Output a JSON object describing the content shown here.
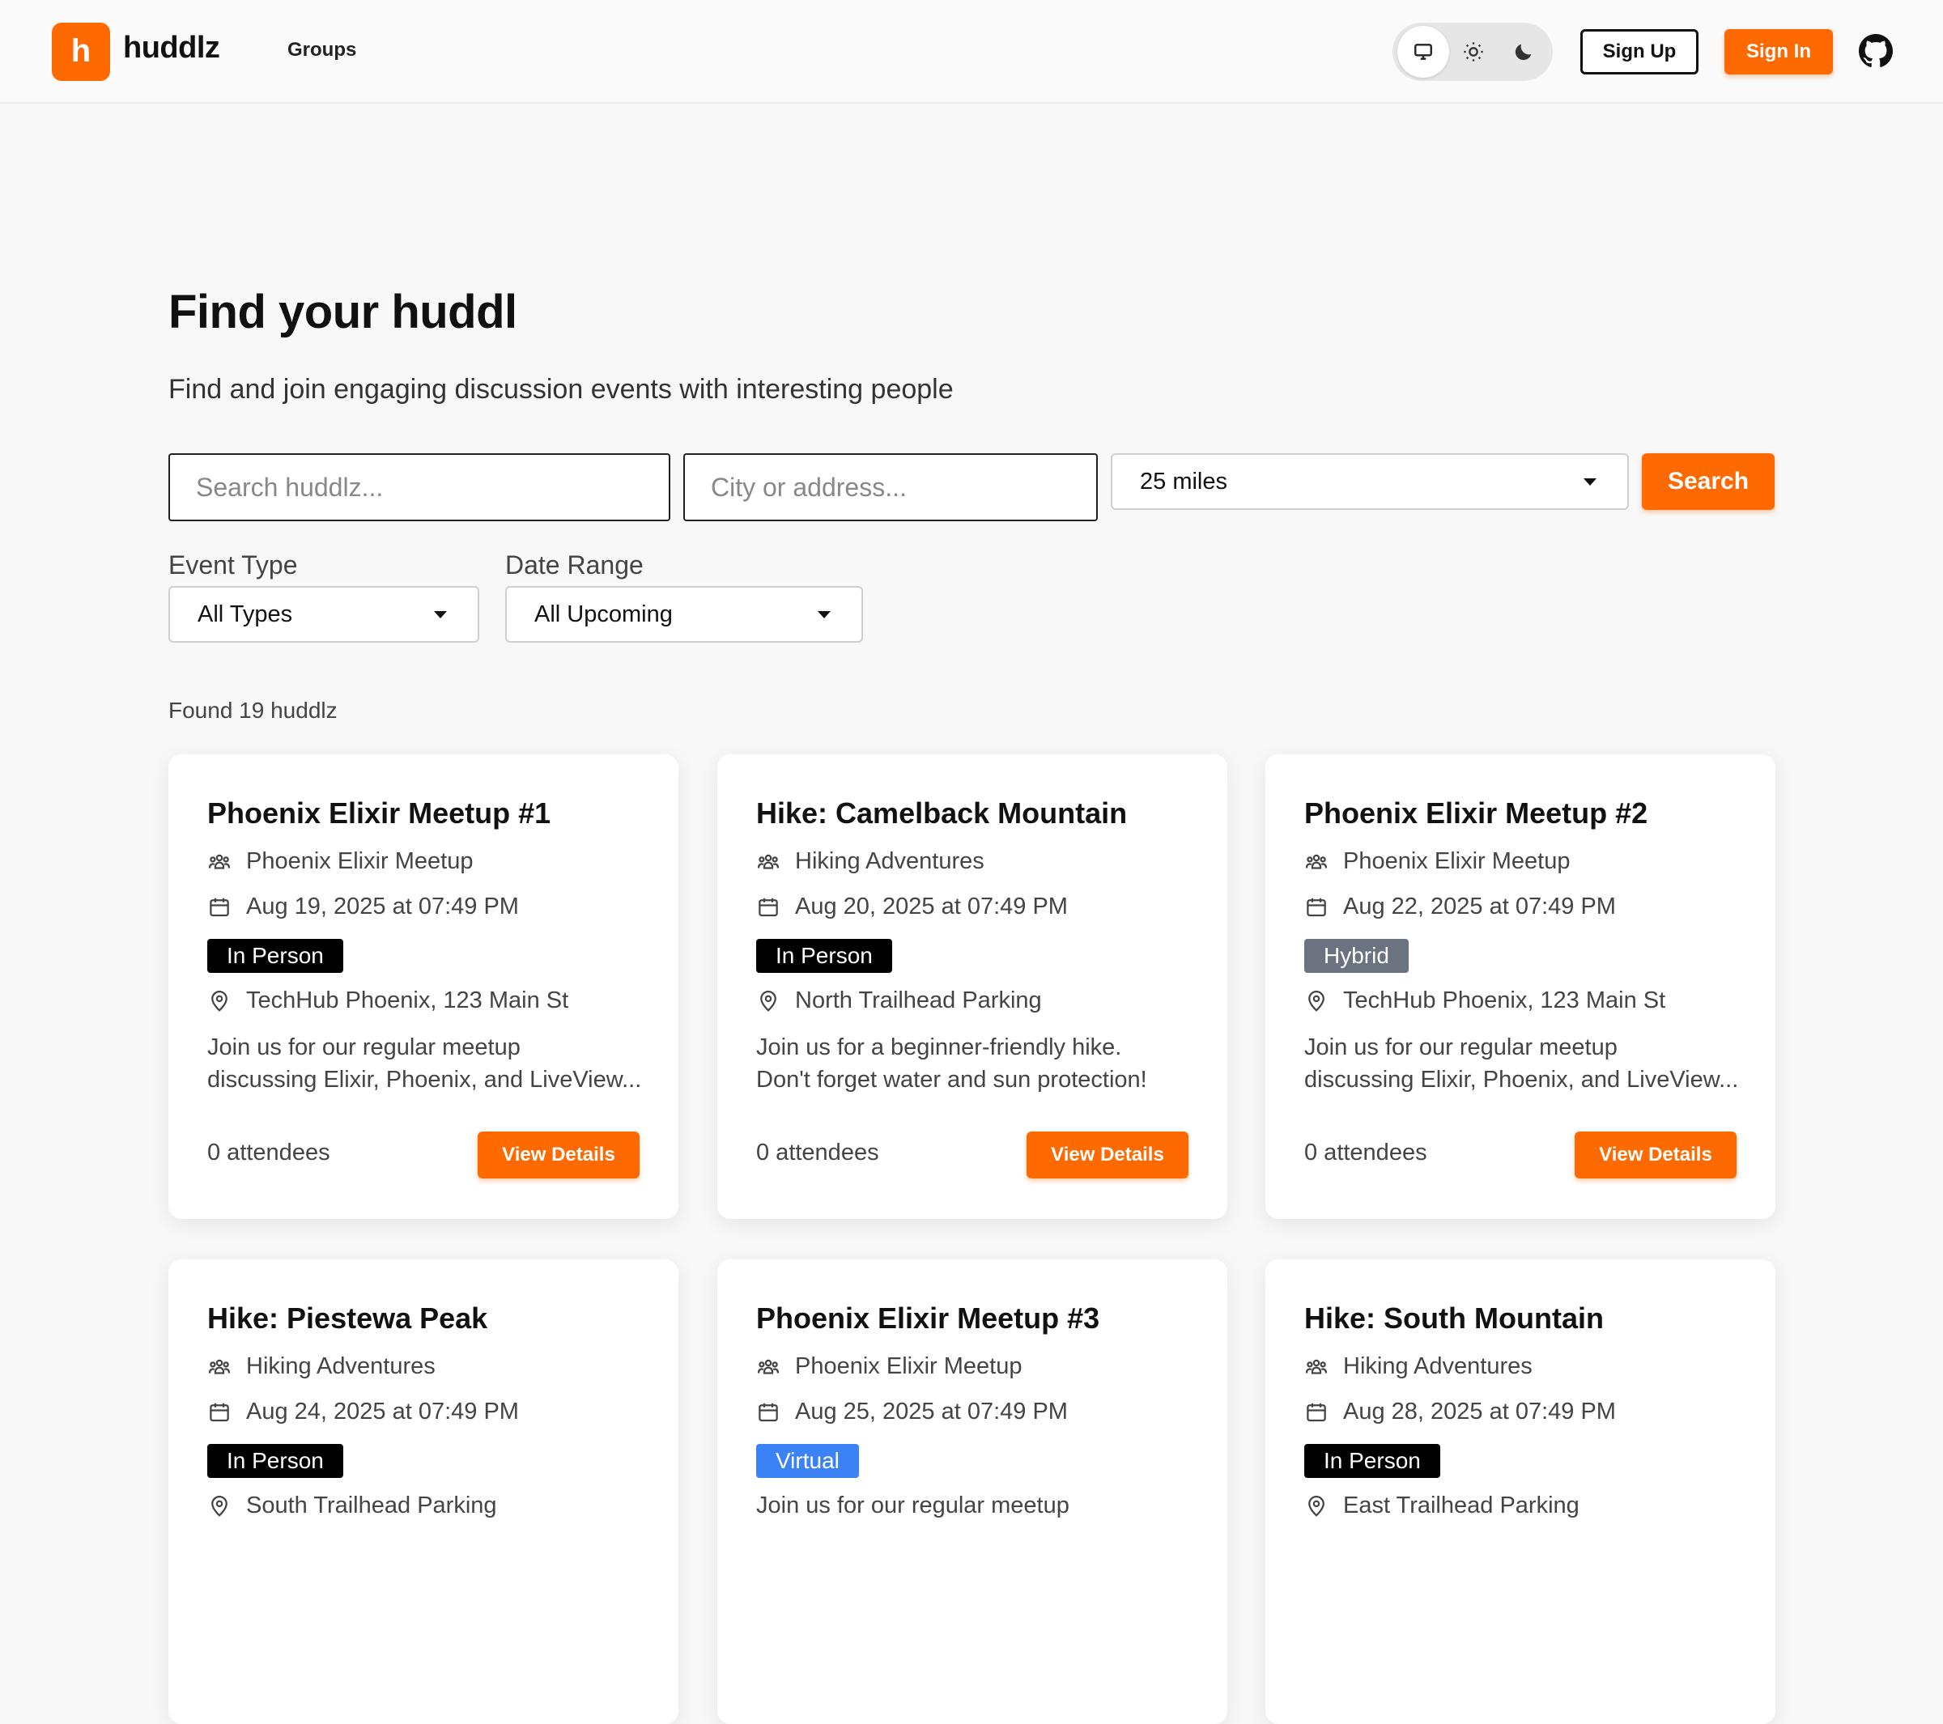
{
  "header": {
    "logo_letter": "h",
    "brand": "huddlz",
    "nav_groups": "Groups",
    "sign_up": "Sign Up",
    "sign_in": "Sign In"
  },
  "hero": {
    "title": "Find your huddl",
    "subtitle": "Find and join engaging discussion events with interesting people"
  },
  "search": {
    "query_placeholder": "Search huddlz...",
    "location_placeholder": "City or address...",
    "radius": "25 miles",
    "button": "Search"
  },
  "filters": {
    "event_type_label": "Event Type",
    "event_type_value": "All Types",
    "date_range_label": "Date Range",
    "date_range_value": "All Upcoming"
  },
  "results": {
    "found_text": "Found 19 huddlz",
    "view_details": "View Details",
    "cards": [
      {
        "title": "Phoenix Elixir Meetup #1",
        "group": "Phoenix Elixir Meetup",
        "date": "Aug 19, 2025 at 07:49 PM",
        "type": "In Person",
        "location": "TechHub Phoenix, 123 Main St",
        "desc1": "Join us for our regular meetup",
        "desc2": "discussing Elixir, Phoenix, and LiveView...",
        "attendees": "0 attendees"
      },
      {
        "title": "Hike: Camelback Mountain",
        "group": "Hiking Adventures",
        "date": "Aug 20, 2025 at 07:49 PM",
        "type": "In Person",
        "location": "North Trailhead Parking",
        "desc1": "Join us for a beginner-friendly hike.",
        "desc2": "Don't forget water and sun protection!",
        "attendees": "0 attendees"
      },
      {
        "title": "Phoenix Elixir Meetup #2",
        "group": "Phoenix Elixir Meetup",
        "date": "Aug 22, 2025 at 07:49 PM",
        "type": "Hybrid",
        "location": "TechHub Phoenix, 123 Main St",
        "desc1": "Join us for our regular meetup",
        "desc2": "discussing Elixir, Phoenix, and LiveView...",
        "attendees": "0 attendees"
      },
      {
        "title": "Hike: Piestewa Peak",
        "group": "Hiking Adventures",
        "date": "Aug 24, 2025 at 07:49 PM",
        "type": "In Person",
        "location": "South Trailhead Parking"
      },
      {
        "title": "Phoenix Elixir Meetup #3",
        "group": "Phoenix Elixir Meetup",
        "date": "Aug 25, 2025 at 07:49 PM",
        "type": "Virtual",
        "desc1": "Join us for our regular meetup"
      },
      {
        "title": "Hike: South Mountain",
        "group": "Hiking Adventures",
        "date": "Aug 28, 2025 at 07:49 PM",
        "type": "In Person",
        "location": "East Trailhead Parking"
      }
    ]
  },
  "colors": {
    "accent": "#ff6a00",
    "badge_in_person": "#000000",
    "badge_hybrid": "#6b7280",
    "badge_virtual": "#3b82f6"
  }
}
